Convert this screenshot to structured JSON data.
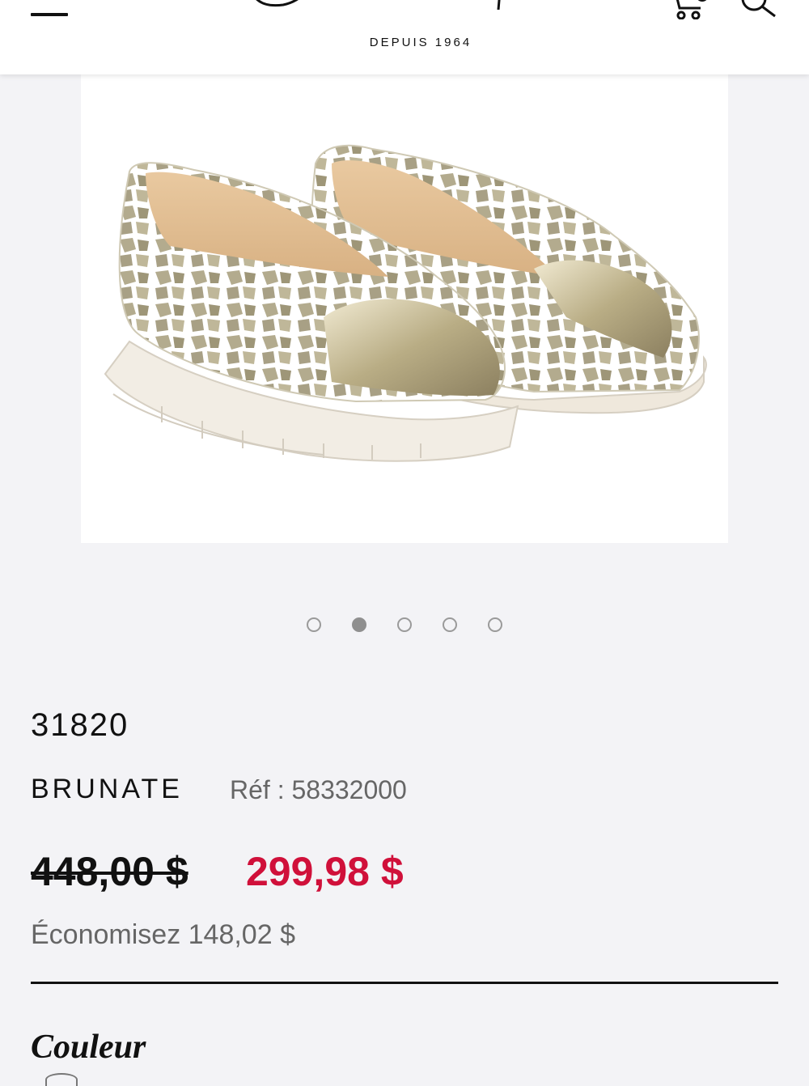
{
  "header": {
    "logo_text": "Jean-Paul Fortin",
    "logo_tagline": "DEPUIS 1964",
    "icons": [
      "menu-icon",
      "cart-icon",
      "search-icon"
    ]
  },
  "gallery": {
    "image_alt": "BRUNATE",
    "dots_count": 5,
    "active_index": 1
  },
  "product": {
    "model": "31820",
    "name": "BRUNATE",
    "reference": "Réf : 58332000",
    "old_price": "448,00 $",
    "sale_price": "299,98 $",
    "savings": "Économisez 148,02  $",
    "color_heading": "Couleur"
  },
  "colors": {
    "sale": "#d0103a",
    "text": "#111111",
    "muted": "#666666",
    "background": "#f3f3f6"
  }
}
